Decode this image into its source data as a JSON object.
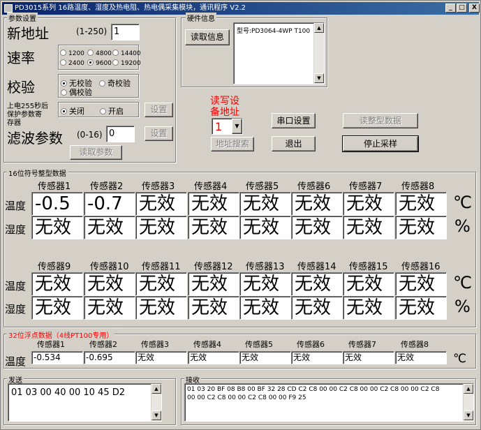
{
  "window": {
    "title": "PD3015系列 16路温度、湿度及热电阻、热电偶采集模块，通讯程序 V2.2",
    "min": "_",
    "max": "□",
    "close": "X"
  },
  "params": {
    "group_label": "参数设置",
    "new_address_label": "新地址",
    "new_address_range": "(1-250)",
    "new_address_value": "1",
    "baud_label": "速率",
    "baud_options": [
      "1200",
      "4800",
      "14400",
      "2400",
      "9600",
      "19200"
    ],
    "baud_selected": "9600",
    "parity_label": "校验",
    "parity_options": [
      "无校验",
      "奇校验",
      "偶校验"
    ],
    "parity_selected": "无校验",
    "protect_label_1": "上电255秒后",
    "protect_label_2": "保护参数寄",
    "protect_label_3": "存器",
    "protect_options": [
      "关闭",
      "开启"
    ],
    "protect_selected": "关闭",
    "set_button_1": "设置",
    "filter_label": "滤波参数",
    "filter_range": "(0-16)",
    "filter_value": "0",
    "set_button_2": "设置",
    "read_params_button": "读取参数"
  },
  "hardware": {
    "group_label": "硬件信息",
    "read_info_button": "读取信息",
    "info_text": "型号:PD3064-4WP T100"
  },
  "device": {
    "label_line1": "读写设",
    "label_line2": "备地址",
    "address_value": "1",
    "search_button": "地址搜索",
    "serial_button": "串口设置",
    "exit_button": "退出",
    "read_int_button": "读整型数据",
    "stop_button": "停止采样"
  },
  "int_data": {
    "group_label": "16位符号整型数据",
    "row_temp": "温度",
    "row_hum": "湿度",
    "unit_temp": "℃",
    "unit_hum": "%",
    "headers_1": [
      "传感器1",
      "传感器2",
      "传感器3",
      "传感器4",
      "传感器5",
      "传感器6",
      "传感器7",
      "传感器8"
    ],
    "temp_1": [
      "-0.5",
      "-0.7",
      "无效",
      "无效",
      "无效",
      "无效",
      "无效",
      "无效"
    ],
    "hum_1": [
      "无效",
      "无效",
      "无效",
      "无效",
      "无效",
      "无效",
      "无效",
      "无效"
    ],
    "headers_2": [
      "传感器9",
      "传感器10",
      "传感器11",
      "传感器12",
      "传感器13",
      "传感器14",
      "传感器15",
      "传感器16"
    ],
    "temp_2": [
      "无效",
      "无效",
      "无效",
      "无效",
      "无效",
      "无效",
      "无效",
      "无效"
    ],
    "hum_2": [
      "无效",
      "无效",
      "无效",
      "无效",
      "无效",
      "无效",
      "无效",
      "无效"
    ]
  },
  "float_data": {
    "group_label": "32位浮点数据（4线PT100专用）",
    "row_temp": "温度",
    "unit_temp": "℃",
    "headers": [
      "传感器1",
      "传感器2",
      "传感器3",
      "传感器4",
      "传感器5",
      "传感器6",
      "传感器7",
      "传感器8"
    ],
    "temp": [
      "-0.534",
      "-0.695",
      "无效",
      "无效",
      "无效",
      "无效",
      "无效",
      "无效"
    ]
  },
  "send": {
    "group_label": "发送",
    "text": "01 03 00 40 00 10 45 D2"
  },
  "receive": {
    "group_label": "接收",
    "line1": "01 03 20 BF 08 B8 00 BF 32 28 CD C2 C8 00 00 C2 C8 00 00 C2 C8 00 00 C2 C8",
    "line2": "00 00 C2 C8 00 00 C2 C8 00 00 F9 25"
  },
  "colors": {
    "face": "#d4d0c8",
    "title_start": "#0a246a",
    "title_end": "#3a6ea5",
    "accent_red": "#ff0000"
  }
}
